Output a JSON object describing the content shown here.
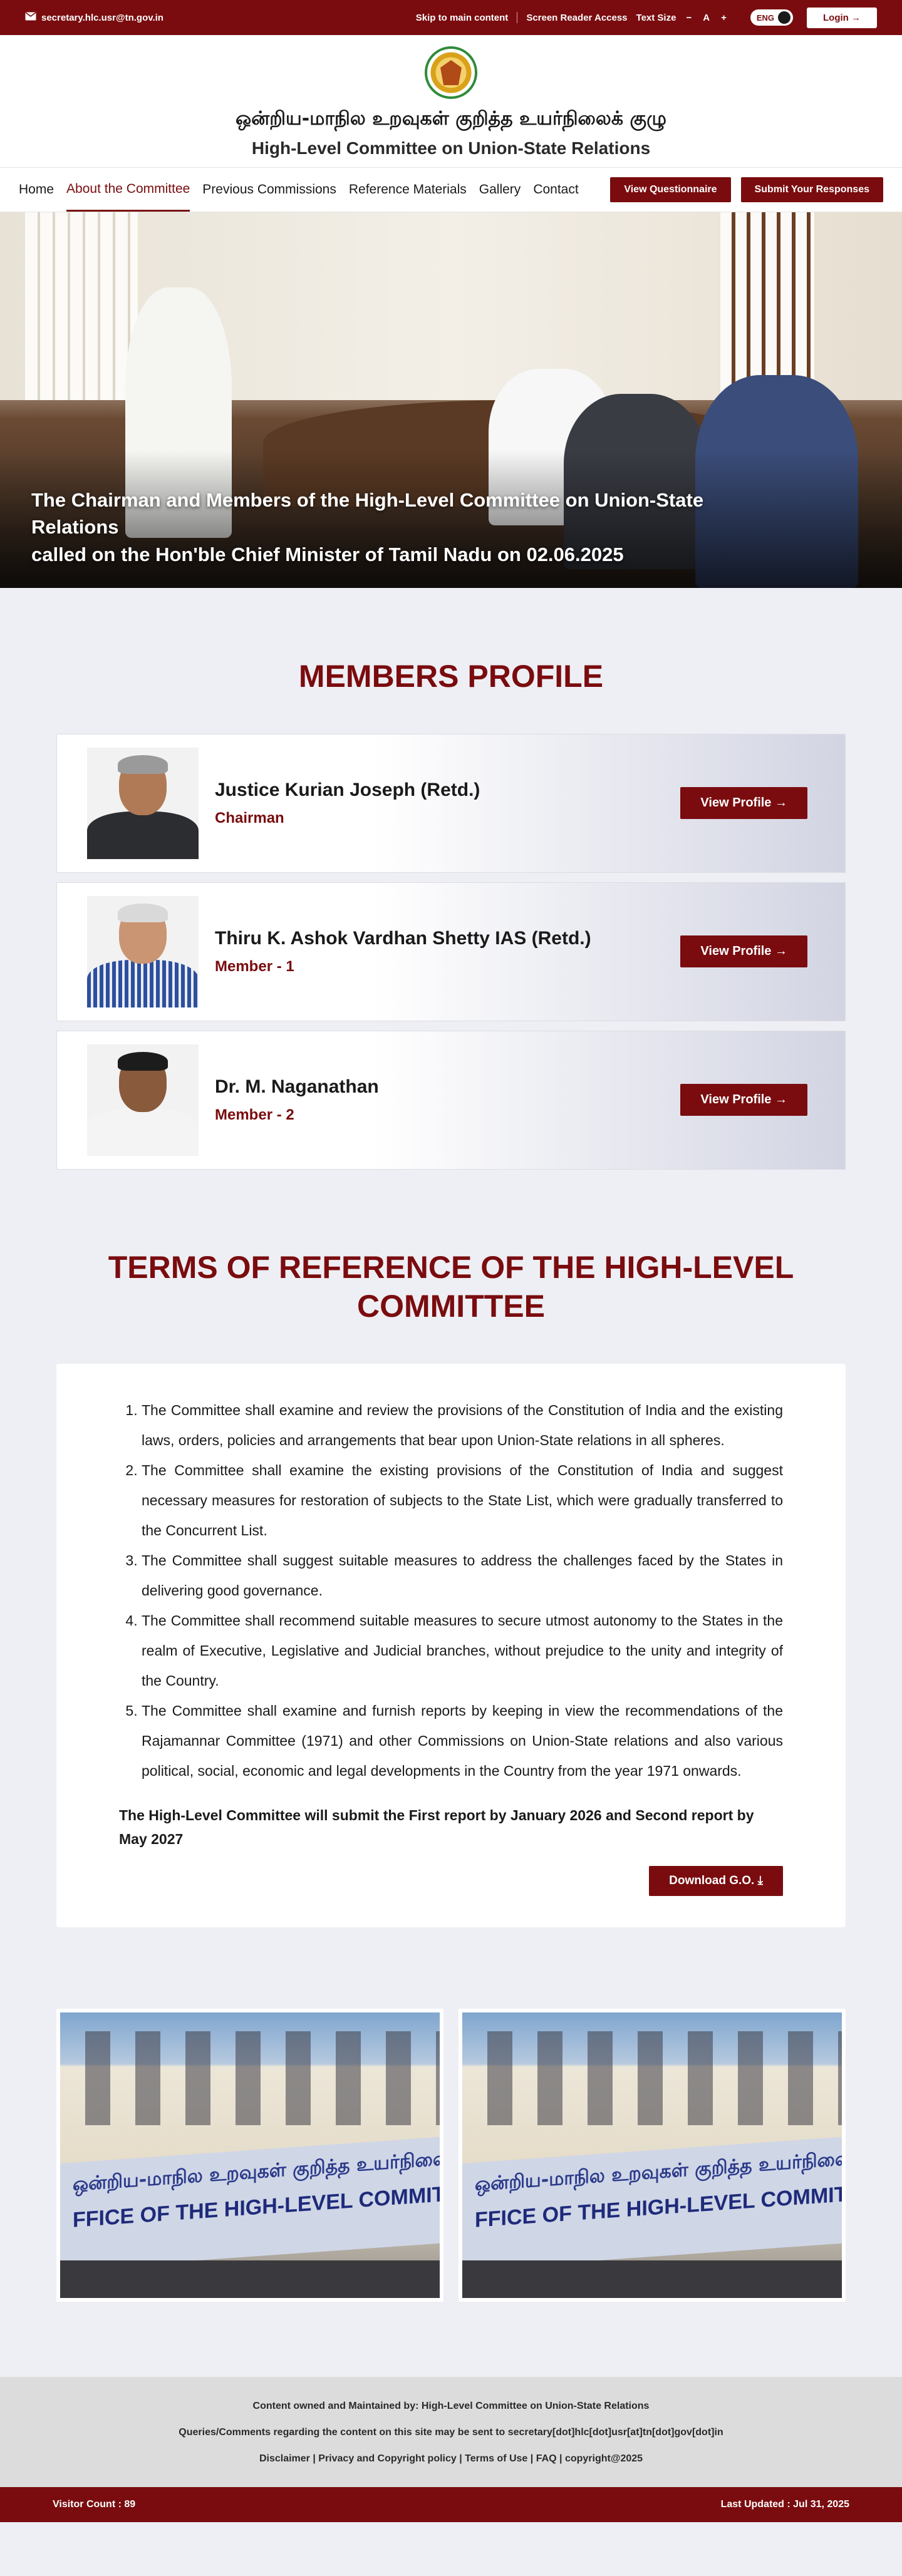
{
  "topbar": {
    "email": "secretary.hlc.usr@tn.gov.in",
    "skip_link": "Skip to main content",
    "screen_reader": "Screen Reader Access",
    "text_size_label": "Text Size",
    "text_decrease": "−",
    "text_normal": "A",
    "text_increase": "+",
    "lang": "ENG",
    "login": "Login →"
  },
  "header": {
    "title_ta": "ஒன்றிய-மாநில உறவுகள் குறித்த  உயர்நிலைக் குழு",
    "title_en": "High-Level Committee on Union-State Relations"
  },
  "nav": {
    "links": [
      "Home",
      "About the Committee",
      "Previous Commissions",
      "Reference Materials",
      "Gallery",
      "Contact"
    ],
    "active": 1,
    "questionnaire": "View Questionnaire",
    "submit": "Submit Your Responses"
  },
  "hero": {
    "caption_line1": "The Chairman and Members of the High-Level Committee on Union-State Relations",
    "caption_line2": "called on the Hon'ble Chief Minister of Tamil Nadu on 02.06.2025"
  },
  "members": {
    "title": "MEMBERS PROFILE",
    "items": [
      {
        "name": "Justice Kurian Joseph (Retd.)",
        "role": "Chairman",
        "button": "View Profile →"
      },
      {
        "name": "Thiru K. Ashok Vardhan Shetty IAS (Retd.)",
        "role": "Member - 1",
        "button": "View Profile →"
      },
      {
        "name": "Dr. M. Naganathan",
        "role": "Member - 2",
        "button": "View Profile →"
      }
    ]
  },
  "tor": {
    "title": "TERMS OF REFERENCE OF THE HIGH-LEVEL COMMITTEE",
    "items": [
      "The Committee shall examine and review the provisions of the Constitution of India and the existing laws, orders, policies and arrangements that bear upon Union-State relations in all spheres.",
      "The Committee shall examine the existing provisions of the Constitution of India and suggest necessary measures for restoration of subjects to the State List, which were gradually transferred to the Concurrent List.",
      "The Committee shall suggest suitable measures to address the challenges faced by the States in delivering good governance.",
      "The Committee shall recommend suitable measures to secure utmost autonomy to the States in the realm of Executive, Legislative and Judicial branches, without prejudice to the unity and integrity of the Country.",
      "The Committee shall examine and furnish reports by keeping in view the recommendations of the Rajamannar Committee (1971) and other Commissions on Union-State relations and also various political, social, economic and legal developments in the Country from the year 1971 onwards."
    ],
    "note": "The High-Level Committee will submit the First report by January 2026 and Second report by May 2027",
    "download": "Download G.O.  ⤓"
  },
  "gallery": {
    "banner_ta": "ஒன்றிய-மாநில உறவுகள் குறித்த உயர்நிலைக் குழு அலுவலக",
    "banner_en": "FFICE OF THE HIGH-LEVEL COMMITTEE ON UNION-STATE RELATI"
  },
  "footer": {
    "line1": "Content owned and Maintained by: High-Level Committee on Union-State Relations",
    "line2": "Queries/Comments regarding the content on this site may be sent to secretary[dot]hlc[dot]usr[at]tn[dot]gov[dot]in",
    "line3": "Disclaimer | Privacy and Copyright policy | Terms of Use | FAQ | copyright@2025",
    "visitor_count": "Visitor Count : 89",
    "last_updated": "Last Updated : Jul 31, 2025"
  },
  "colors": {
    "brand": "#7a0c0f",
    "page_bg": "#eeeff4"
  }
}
